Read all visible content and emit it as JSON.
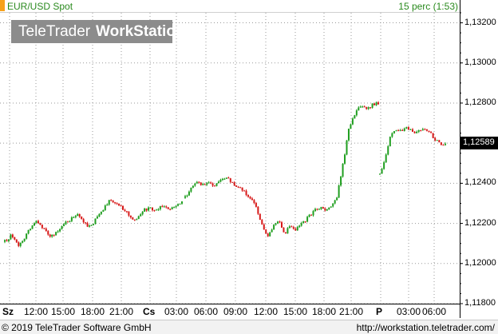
{
  "header": {
    "instrument": "EUR/USD Spot",
    "interval": "15 perc (1:53)"
  },
  "watermark": {
    "part1": "TeleTrader",
    "part2": "WorkStation"
  },
  "price_axis": {
    "ticks": [
      "1,13200",
      "1,13000",
      "1,12800",
      "1,12600",
      "1,12400",
      "1,12200",
      "1,12000",
      "1,11800"
    ],
    "last_price": "1,12589"
  },
  "time_axis": {
    "labels": [
      "Sz",
      "12:00",
      "15:00",
      "18:00",
      "21:00",
      "Cs",
      "03:00",
      "06:00",
      "09:00",
      "12:00",
      "15:00",
      "18:00",
      "21:00",
      "P",
      "03:00",
      "06:00"
    ]
  },
  "footer": {
    "copyright": "© 2019 TeleTrader Software GmbH",
    "url": "http://workstation.teletrader.com/"
  },
  "colors": {
    "up": "#1f9e1f",
    "down": "#d71818",
    "title": "#2a8a1e",
    "accent": "#f7a21b"
  },
  "chart_data": {
    "type": "candlestick",
    "interval": "15 perc",
    "ylim": [
      1.118,
      1.1325
    ],
    "grid": true,
    "sessions": [
      {
        "label": "Sz",
        "close_path": [
          1.1211,
          1.1214,
          1.1209,
          1.1213,
          1.1218,
          1.1221,
          1.1217,
          1.1213,
          1.1216,
          1.122,
          1.1222,
          1.1225,
          1.122,
          1.1218,
          1.1223,
          1.1227,
          1.1232,
          1.123,
          1.1227,
          1.1224,
          1.1221,
          1.1226,
          1.1228,
          1.1226,
          1.1229,
          1.1227,
          1.1228,
          1.1231
        ]
      },
      {
        "label": "Cs",
        "close_path": [
          1.1233,
          1.1238,
          1.1241,
          1.1239,
          1.124,
          1.1239,
          1.1242,
          1.1243,
          1.124,
          1.1238,
          1.1236,
          1.1233,
          1.123,
          1.122,
          1.1213,
          1.1218,
          1.1222,
          1.1215,
          1.1219,
          1.1217,
          1.122,
          1.1223,
          1.1226,
          1.1228,
          1.1226,
          1.1229,
          1.1234,
          1.125,
          1.1268,
          1.1275,
          1.1279,
          1.1277,
          1.1279,
          1.128
        ]
      },
      {
        "label": "P",
        "close_path": [
          1.1245,
          1.1252,
          1.1265,
          1.1267,
          1.1266,
          1.1268,
          1.1265,
          1.1266,
          1.1268,
          1.1266,
          1.1262,
          1.126,
          1.1259
        ]
      }
    ]
  }
}
